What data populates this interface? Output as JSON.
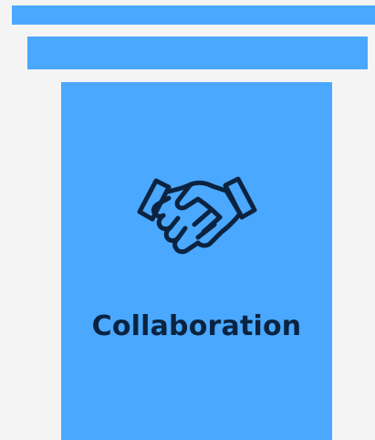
{
  "card": {
    "title": "Collaboration",
    "icon": "handshake-icon"
  },
  "colors": {
    "page_background": "#f4f4f4",
    "accent_blue": "#4aa8ff",
    "icon_and_text": "#0b2340"
  }
}
